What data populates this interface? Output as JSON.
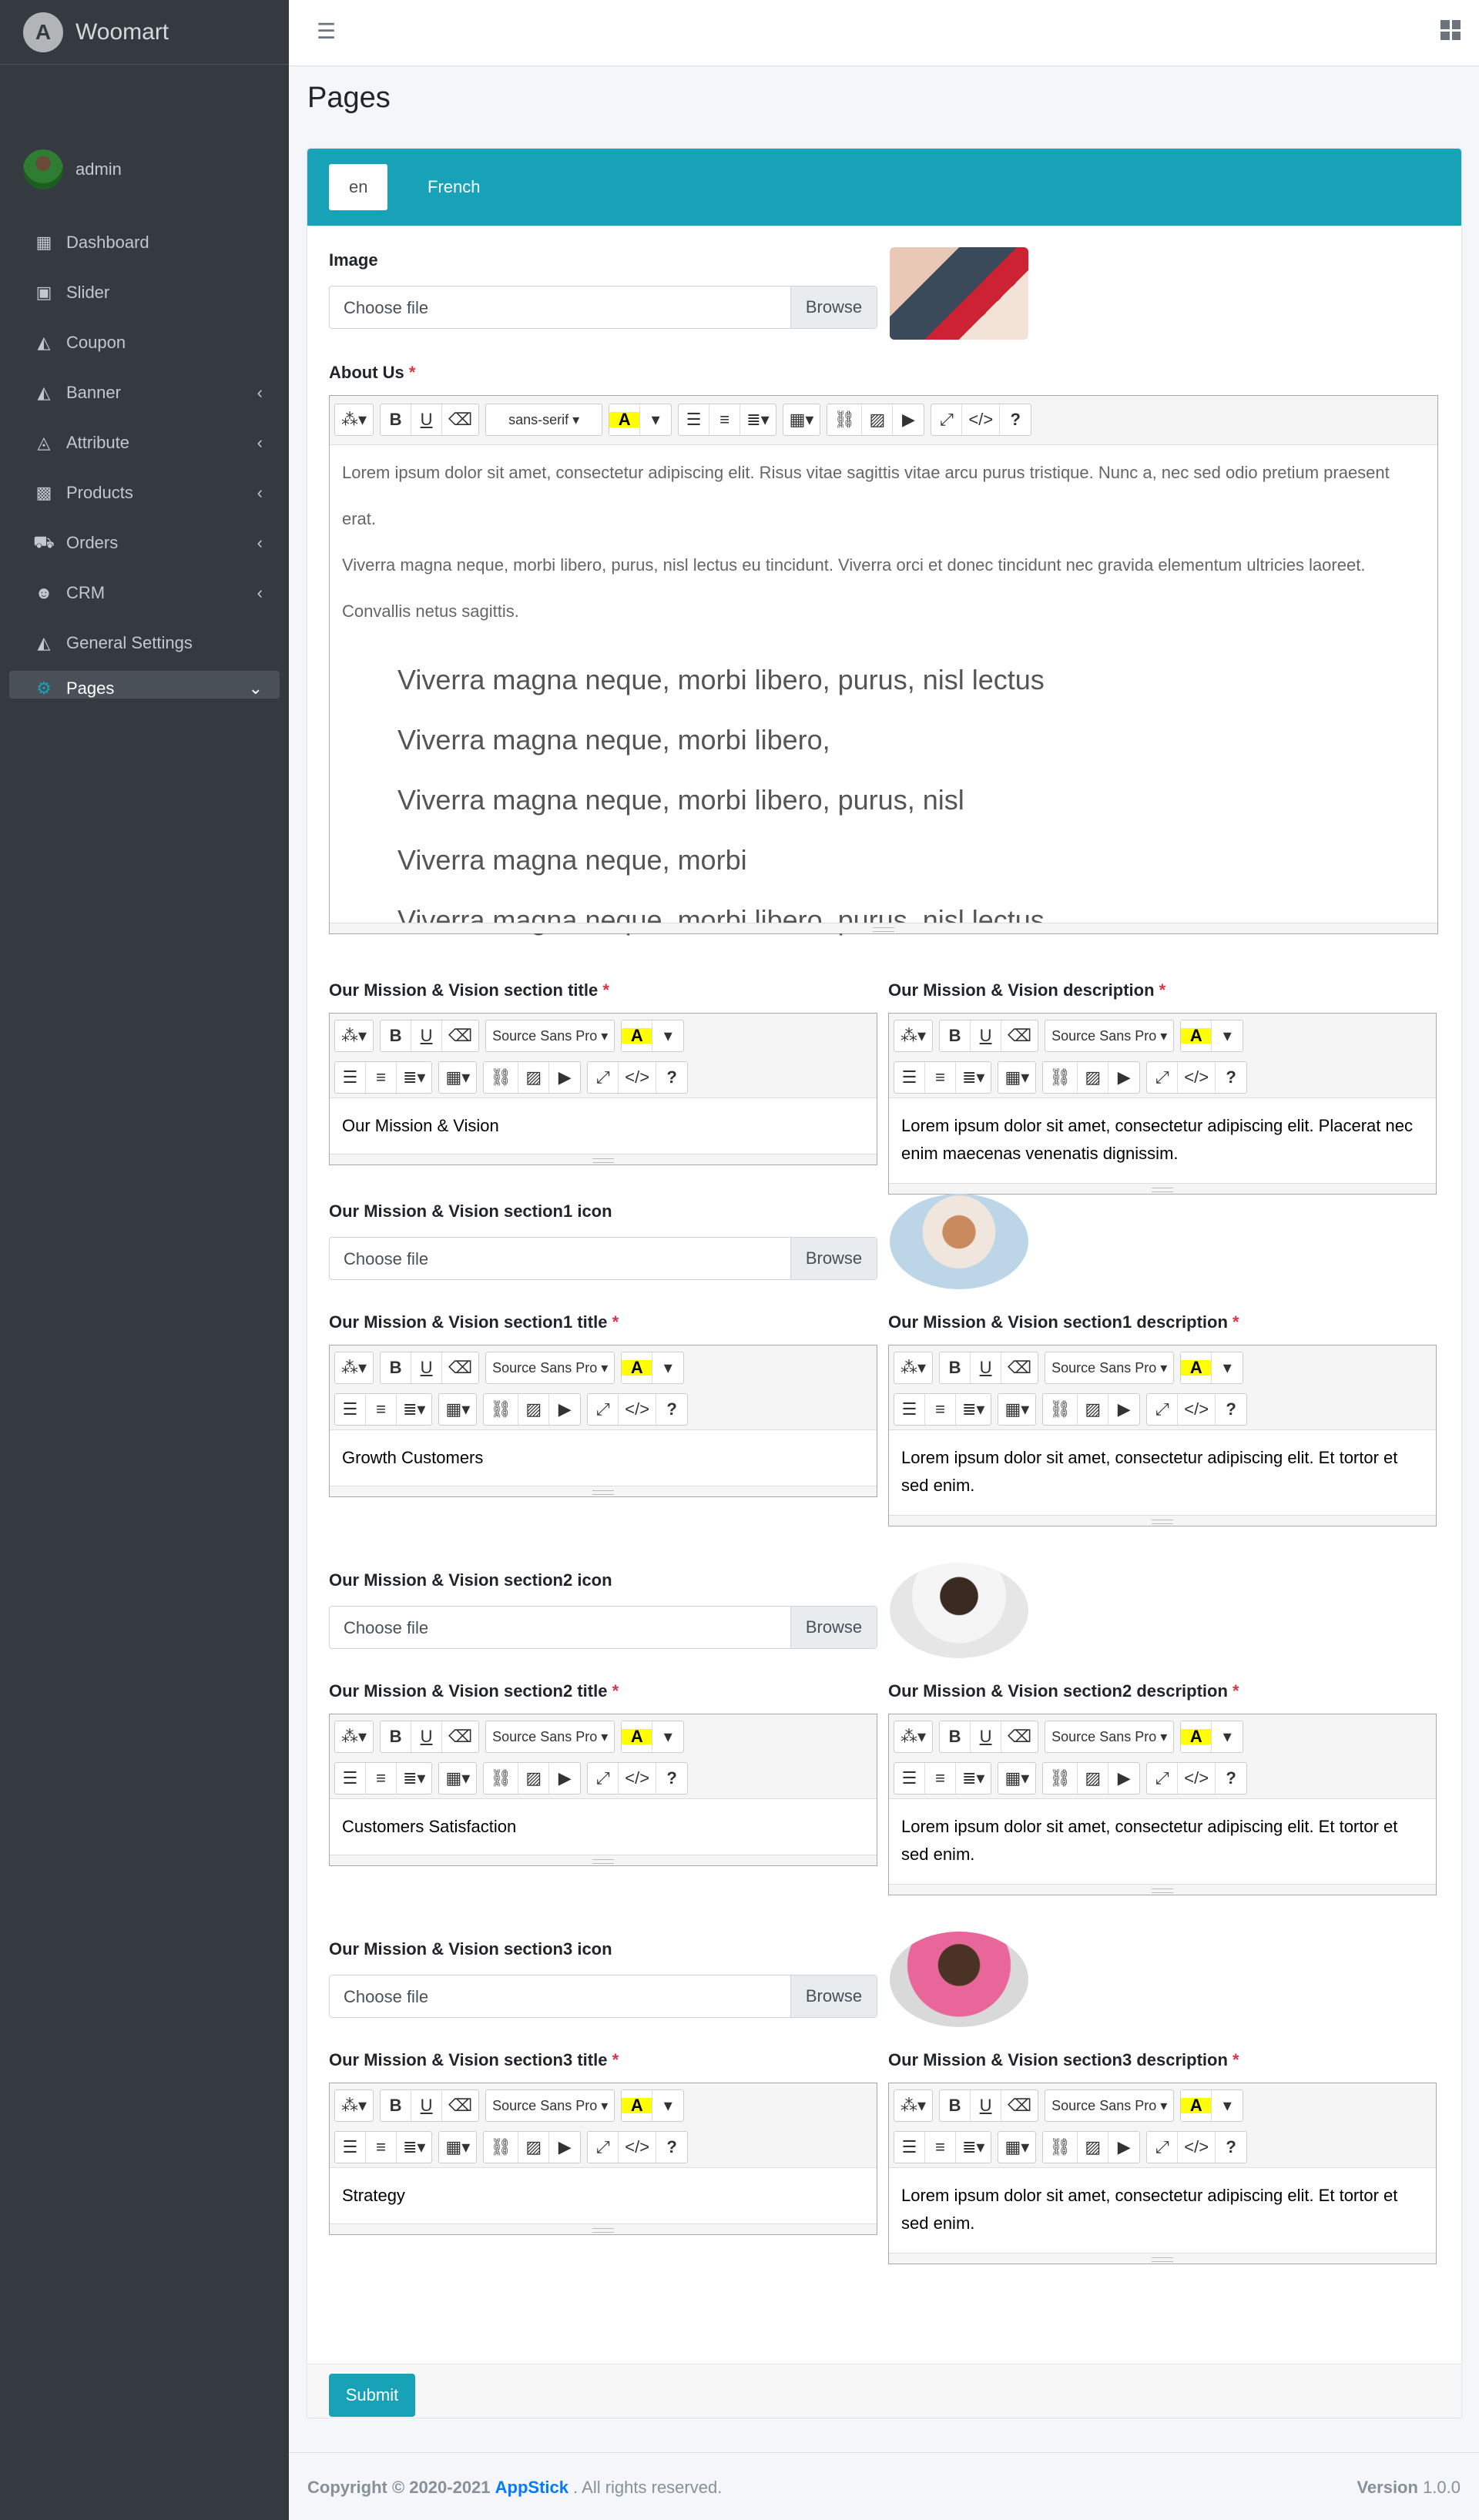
{
  "brand": {
    "name": "Woomart",
    "logo": "A"
  },
  "user": {
    "name": "admin"
  },
  "nav": [
    {
      "label": "Dashboard",
      "icon": "▦",
      "arrow": ""
    },
    {
      "label": "Slider",
      "icon": "▣",
      "arrow": ""
    },
    {
      "label": "Coupon",
      "icon": "◭",
      "arrow": ""
    },
    {
      "label": "Banner",
      "icon": "◭",
      "arrow": "‹"
    },
    {
      "label": "Attribute",
      "icon": "◬",
      "arrow": "‹"
    },
    {
      "label": "Products",
      "icon": "▩",
      "arrow": "‹"
    },
    {
      "label": "Orders",
      "icon": "⛟",
      "arrow": "‹"
    },
    {
      "label": "CRM",
      "icon": "☻",
      "arrow": "‹"
    },
    {
      "label": "General Settings",
      "icon": "◭",
      "arrow": ""
    },
    {
      "label": "Pages",
      "icon": "⚙",
      "arrow": "⌄"
    }
  ],
  "page": {
    "title": "Pages"
  },
  "tabs": [
    "en",
    "French"
  ],
  "image": {
    "label": "Image"
  },
  "file": {
    "placeholder": "Choose file",
    "browse": "Browse"
  },
  "about": {
    "label": "About Us",
    "req": "*",
    "font": "sans-serif",
    "p1": "Lorem ipsum dolor sit amet, consectetur adipiscing elit. Risus vitae sagittis vitae arcu purus tristique. Nunc a, nec sed odio pretium praesent erat.",
    "p2": "Viverra magna neque, morbi libero, purus, nisl lectus eu tincidunt. Viverra orci et donec tincidunt nec gravida elementum ultricies laoreet.",
    "p3": "Convallis netus sagittis.",
    "list": [
      "Viverra magna neque, morbi libero, purus, nisl lectus",
      "Viverra magna neque, morbi libero,",
      "Viverra magna neque, morbi libero, purus, nisl",
      "Viverra magna neque, morbi",
      "Viverra magna neque, morbi libero, purus, nisl lectus"
    ]
  },
  "mission": {
    "title_label": "Our Mission & Vision section title",
    "title_value": "Our Mission & Vision",
    "desc_label": "Our Mission & Vision description",
    "desc_value": "Lorem ipsum dolor sit amet, consectetur adipiscing elit. Placerat nec enim maecenas venenatis dignissim.",
    "font": "Source Sans Pro"
  },
  "sections": [
    {
      "icon_label": "Our Mission & Vision section1 icon",
      "title_label": "Our Mission & Vision section1 title",
      "title_value": "Growth Customers",
      "desc_label": "Our Mission & Vision section1 description",
      "desc_value": "Lorem ipsum dolor sit amet, consectetur adipiscing elit. Et tortor et sed enim."
    },
    {
      "icon_label": "Our Mission & Vision section2 icon",
      "title_label": "Our Mission & Vision section2 title",
      "title_value": "Customers Satisfaction",
      "desc_label": "Our Mission & Vision section2 description",
      "desc_value": "Lorem ipsum dolor sit amet, consectetur adipiscing elit. Et tortor et sed enim."
    },
    {
      "icon_label": "Our Mission & Vision section3 icon",
      "title_label": "Our Mission & Vision section3 title",
      "title_value": "Strategy",
      "desc_label": "Our Mission & Vision section3 description",
      "desc_value": "Lorem ipsum dolor sit amet, consectetur adipiscing elit. Et tortor et sed enim."
    }
  ],
  "submit": "Submit",
  "footer": {
    "copy": "Copyright © 2020-2021",
    "company": "AppStick",
    "rights": ". All rights reserved.",
    "version_label": "Version",
    "version": "1.0.0"
  }
}
